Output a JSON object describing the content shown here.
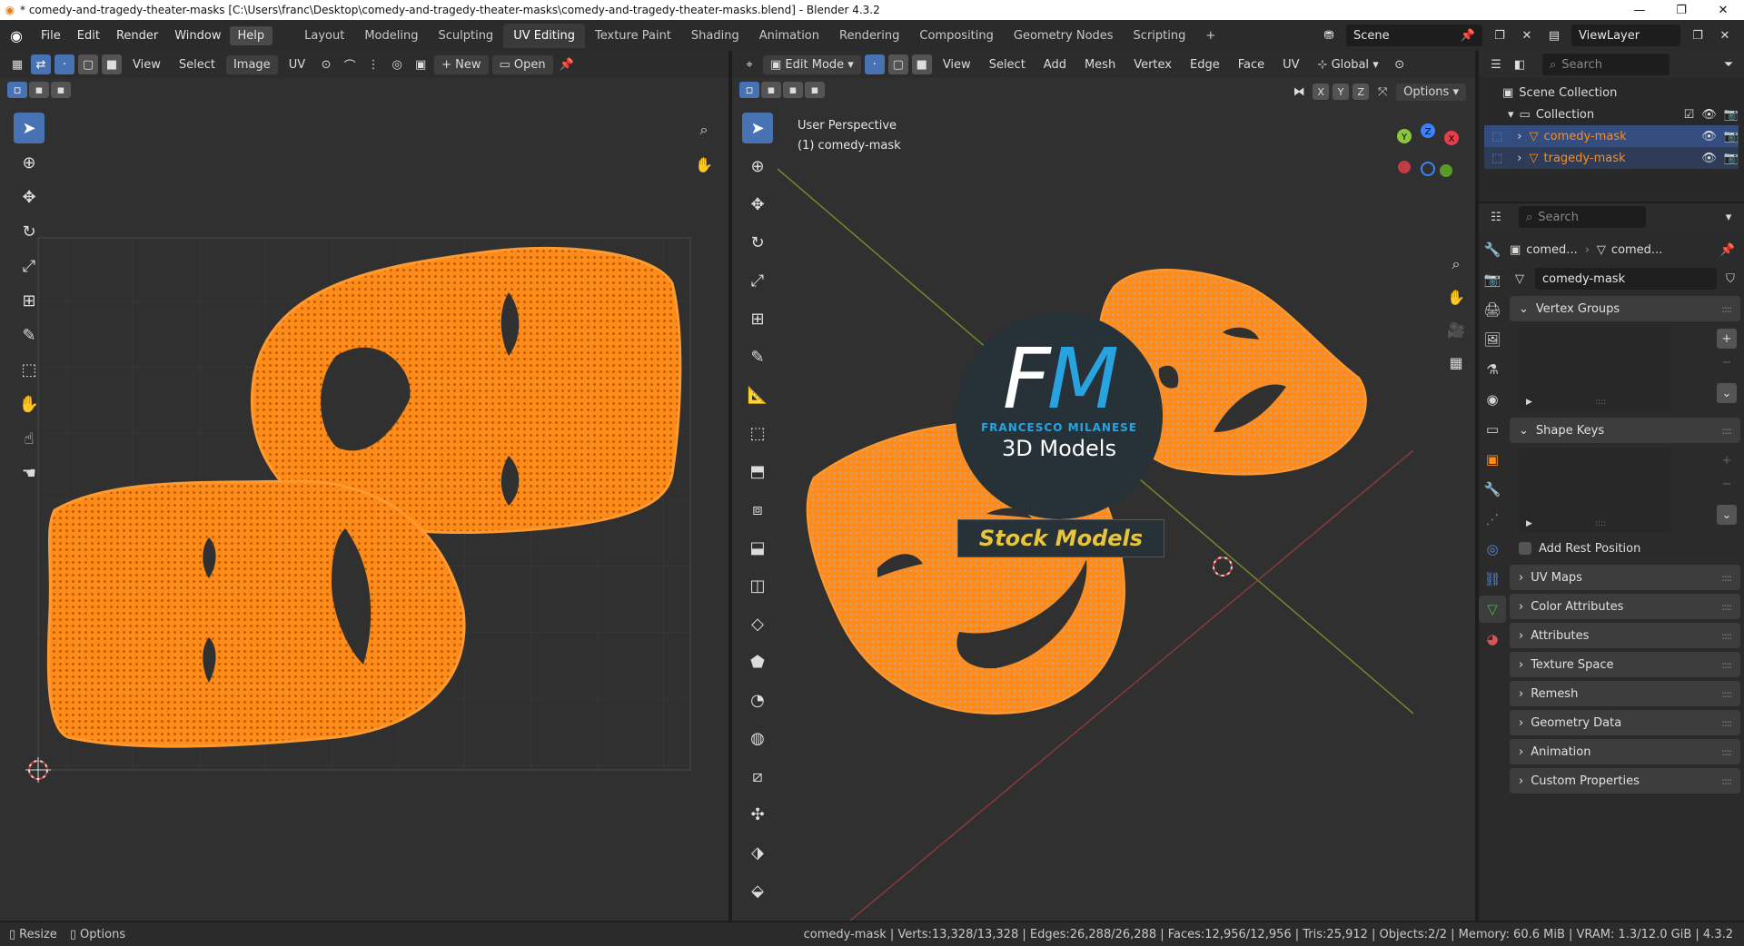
{
  "window": {
    "title": "* comedy-and-tragedy-theater-masks [C:\\Users\\franc\\Desktop\\comedy-and-tragedy-theater-masks\\comedy-and-tragedy-theater-masks.blend] - Blender 4.3.2",
    "minimize": "—",
    "maximize": "❐",
    "close": "✕"
  },
  "menu": [
    "File",
    "Edit",
    "Render",
    "Window",
    "Help"
  ],
  "workspaces": [
    "Layout",
    "Modeling",
    "Sculpting",
    "UV Editing",
    "Texture Paint",
    "Shading",
    "Animation",
    "Rendering",
    "Compositing",
    "Geometry Nodes",
    "Scripting"
  ],
  "workspace_add": "+",
  "scene": {
    "name": "Scene",
    "view_layer": "ViewLayer"
  },
  "uv_editor": {
    "menus": [
      "View",
      "Select",
      "Image",
      "UV"
    ],
    "new_label": "New",
    "open_label": "Open"
  },
  "viewport": {
    "mode": "Edit Mode",
    "menus": [
      "View",
      "Select",
      "Add",
      "Mesh",
      "Vertex",
      "Edge",
      "Face",
      "UV"
    ],
    "orientation": "Global",
    "axis_labels": [
      "X",
      "Y",
      "Z"
    ],
    "options_label": "Options",
    "perspective_label": "User Perspective",
    "object_label": "(1) comedy-mask",
    "gizmo": {
      "x": "X",
      "y": "Y",
      "z": "Z"
    }
  },
  "watermark": {
    "f": "F",
    "m": "M",
    "name": "FRANCESCO MILANESE",
    "subtitle": "3D Models",
    "banner": "Stock Models"
  },
  "outliner": {
    "search_placeholder": "Search",
    "scene_collection": "Scene Collection",
    "collection": "Collection",
    "objects": [
      "comedy-mask",
      "tragedy-mask"
    ]
  },
  "properties": {
    "search_placeholder": "Search",
    "breadcrumb_object": "comed...",
    "breadcrumb_data": "comed...",
    "data_name": "comedy-mask",
    "panels": {
      "vertex_groups": "Vertex Groups",
      "shape_keys": "Shape Keys",
      "add_rest_position": "Add Rest Position",
      "collapsed": [
        "UV Maps",
        "Color Attributes",
        "Attributes",
        "Texture Space",
        "Remesh",
        "Geometry Data",
        "Animation",
        "Custom Properties"
      ]
    }
  },
  "statusbar": {
    "resize": "Resize",
    "options": "Options",
    "stats": "comedy-mask | Verts:13,328/13,328 | Edges:26,288/26,288 | Faces:12,956/12,956 | Tris:25,912 | Objects:2/2 | Memory: 60.6 MiB | VRAM: 1.3/12.0 GiB | 4.3.2"
  },
  "colors": {
    "accent_blue": "#4772b3",
    "mesh_orange": "#ff8c1a",
    "background": "#303030",
    "watermark_blue": "#29a3e0",
    "banner_gold": "#e8c53a"
  }
}
